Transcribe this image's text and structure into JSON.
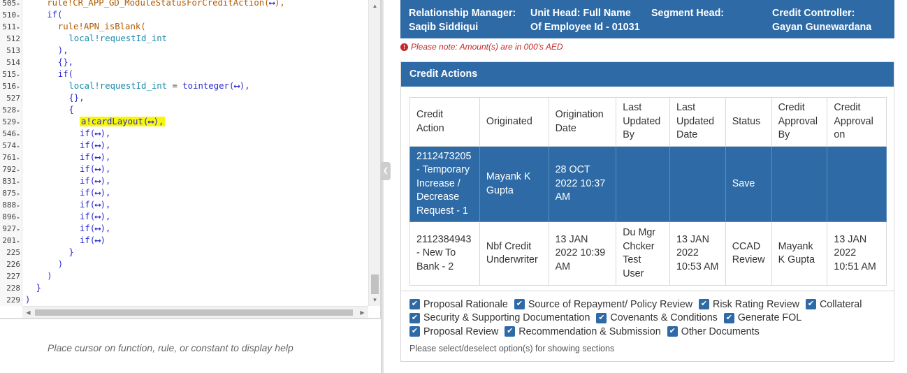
{
  "editor": {
    "gutter": [
      {
        "num": "505",
        "fold": true
      },
      {
        "num": "510",
        "fold": true
      },
      {
        "num": "511",
        "fold": true
      },
      {
        "num": "512",
        "fold": false
      },
      {
        "num": "513",
        "fold": false
      },
      {
        "num": "514",
        "fold": false
      },
      {
        "num": "515",
        "fold": true
      },
      {
        "num": "516",
        "fold": true
      },
      {
        "num": "527",
        "fold": false
      },
      {
        "num": "528",
        "fold": true
      },
      {
        "num": "529",
        "fold": true
      },
      {
        "num": "546",
        "fold": true
      },
      {
        "num": "574",
        "fold": true
      },
      {
        "num": "761",
        "fold": true
      },
      {
        "num": "792",
        "fold": true
      },
      {
        "num": "831",
        "fold": true
      },
      {
        "num": "875",
        "fold": true
      },
      {
        "num": "888",
        "fold": true
      },
      {
        "num": "896",
        "fold": true
      },
      {
        "num": "927",
        "fold": true
      },
      {
        "num": "201",
        "fold": true
      },
      {
        "num": "225",
        "fold": false
      },
      {
        "num": "226",
        "fold": false
      },
      {
        "num": "227",
        "fold": false
      },
      {
        "num": "228",
        "fold": false
      },
      {
        "num": "229",
        "fold": false
      }
    ],
    "lines": [
      {
        "indent": 2,
        "parts": [
          {
            "t": "rule!CR_APP_GD_ModuleStatusForCreditAction(",
            "c": "rule"
          },
          {
            "t": "⟷",
            "c": "expand"
          },
          {
            "t": "),",
            "c": "rule"
          }
        ]
      },
      {
        "indent": 2,
        "parts": [
          {
            "t": "if(",
            "c": "kw"
          }
        ]
      },
      {
        "indent": 3,
        "parts": [
          {
            "t": "rule!APN_isBlank(",
            "c": "rule"
          }
        ]
      },
      {
        "indent": 4,
        "parts": [
          {
            "t": "local!requestId_int",
            "c": "local"
          }
        ]
      },
      {
        "indent": 3,
        "parts": [
          {
            "t": "),",
            "c": "kw"
          }
        ]
      },
      {
        "indent": 3,
        "parts": [
          {
            "t": "{},",
            "c": "kw"
          }
        ]
      },
      {
        "indent": 3,
        "parts": [
          {
            "t": "if(",
            "c": "kw"
          }
        ]
      },
      {
        "indent": 4,
        "parts": [
          {
            "t": "local!requestId_int",
            "c": "local"
          },
          {
            "t": " = ",
            "c": "plain"
          },
          {
            "t": "tointeger(",
            "c": "kw"
          },
          {
            "t": "⟷",
            "c": "expand"
          },
          {
            "t": "),",
            "c": "kw"
          }
        ]
      },
      {
        "indent": 4,
        "parts": [
          {
            "t": "{},",
            "c": "kw"
          }
        ]
      },
      {
        "indent": 4,
        "parts": [
          {
            "t": "{",
            "c": "kw"
          }
        ]
      },
      {
        "indent": 5,
        "hl": true,
        "parts": [
          {
            "t": "a!cardLayout(",
            "c": "kw"
          },
          {
            "t": "⟷",
            "c": "expand"
          },
          {
            "t": "),",
            "c": "kw"
          }
        ]
      },
      {
        "indent": 5,
        "parts": [
          {
            "t": "if(",
            "c": "kw"
          },
          {
            "t": "⟷",
            "c": "expand"
          },
          {
            "t": "),",
            "c": "kw"
          }
        ]
      },
      {
        "indent": 5,
        "parts": [
          {
            "t": "if(",
            "c": "kw"
          },
          {
            "t": "⟷",
            "c": "expand"
          },
          {
            "t": "),",
            "c": "kw"
          }
        ]
      },
      {
        "indent": 5,
        "parts": [
          {
            "t": "if(",
            "c": "kw"
          },
          {
            "t": "⟷",
            "c": "expand"
          },
          {
            "t": "),",
            "c": "kw"
          }
        ]
      },
      {
        "indent": 5,
        "parts": [
          {
            "t": "if(",
            "c": "kw"
          },
          {
            "t": "⟷",
            "c": "expand"
          },
          {
            "t": "),",
            "c": "kw"
          }
        ]
      },
      {
        "indent": 5,
        "parts": [
          {
            "t": "if(",
            "c": "kw"
          },
          {
            "t": "⟷",
            "c": "expand"
          },
          {
            "t": "),",
            "c": "kw"
          }
        ]
      },
      {
        "indent": 5,
        "parts": [
          {
            "t": "if(",
            "c": "kw"
          },
          {
            "t": "⟷",
            "c": "expand"
          },
          {
            "t": "),",
            "c": "kw"
          }
        ]
      },
      {
        "indent": 5,
        "parts": [
          {
            "t": "if(",
            "c": "kw"
          },
          {
            "t": "⟷",
            "c": "expand"
          },
          {
            "t": "),",
            "c": "kw"
          }
        ]
      },
      {
        "indent": 5,
        "parts": [
          {
            "t": "if(",
            "c": "kw"
          },
          {
            "t": "⟷",
            "c": "expand"
          },
          {
            "t": "),",
            "c": "kw"
          }
        ]
      },
      {
        "indent": 5,
        "parts": [
          {
            "t": "if(",
            "c": "kw"
          },
          {
            "t": "⟷",
            "c": "expand"
          },
          {
            "t": "),",
            "c": "kw"
          }
        ]
      },
      {
        "indent": 5,
        "parts": [
          {
            "t": "if(",
            "c": "kw"
          },
          {
            "t": "⟷",
            "c": "expand"
          },
          {
            "t": ")",
            "c": "kw"
          }
        ]
      },
      {
        "indent": 4,
        "parts": [
          {
            "t": "}",
            "c": "kw"
          }
        ]
      },
      {
        "indent": 3,
        "parts": [
          {
            "t": ")",
            "c": "kw"
          }
        ]
      },
      {
        "indent": 2,
        "parts": [
          {
            "t": ")",
            "c": "kw"
          }
        ]
      },
      {
        "indent": 1,
        "parts": [
          {
            "t": "}",
            "c": "kw"
          }
        ]
      },
      {
        "indent": 0,
        "parts": [
          {
            "t": ")",
            "c": "kw"
          }
        ]
      }
    ],
    "help_text": "Place cursor on function, rule, or constant to display help"
  },
  "header": {
    "relationship_manager_label": "Relationship Manager:",
    "relationship_manager_value": "Saqib Siddiqui",
    "unit_head_label": "Unit Head: Full Name",
    "unit_head_value": "Of Employee Id - 01031",
    "segment_head_label": "Segment Head:",
    "credit_controller_label": "Credit Controller:",
    "credit_controller_value": "Gayan Gunewardana"
  },
  "note": "Please note: Amount(s) are in 000's AED",
  "credit_actions": {
    "title": "Credit Actions",
    "columns": [
      "Credit Action",
      "Originated",
      "Origination Date",
      "Last Updated By",
      "Last Updated Date",
      "Status",
      "Credit Approval By",
      "Credit Approval on"
    ],
    "rows": [
      {
        "selected": true,
        "cells": [
          "2112473205 - Temporary Increase / Decrease Request - 1",
          "Mayank K Gupta",
          "28 OCT 2022 10:37 AM",
          "",
          "",
          "Save",
          "",
          ""
        ]
      },
      {
        "selected": false,
        "cells": [
          "2112384943 - New To Bank - 2",
          "Nbf Credit Underwriter",
          "13 JAN 2022 10:39 AM",
          "Du Mgr Chcker Test User",
          "13 JAN 2022 10:53 AM",
          "CCAD Review",
          "Mayank K Gupta",
          "13 JAN 2022 10:51 AM"
        ]
      }
    ]
  },
  "sections": {
    "rows": [
      [
        "Proposal Rationale",
        "Source of Repayment/ Policy Review",
        "Risk Rating Review",
        "Collateral"
      ],
      [
        "Security & Supporting Documentation",
        "Covenants & Conditions",
        "Generate FOL"
      ],
      [
        "Proposal Review",
        "Recommendation & Submission",
        "Other Documents"
      ]
    ],
    "hint": "Please select/deselect option(s) for showing sections"
  },
  "colors": {
    "accent": "#2e6aa6",
    "highlight": "#f7f70a",
    "warning": "#c62828"
  }
}
